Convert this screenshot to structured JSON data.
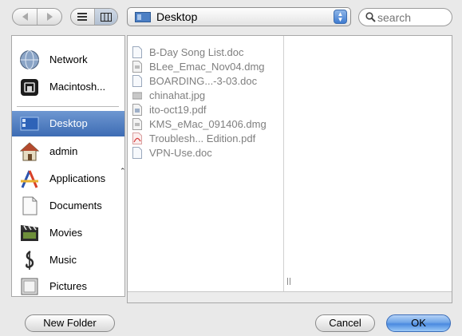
{
  "toolbar": {
    "location": "Desktop",
    "search_placeholder": "search"
  },
  "sidebar": {
    "items": [
      {
        "label": "Network",
        "icon": "network-globe-icon"
      },
      {
        "label": "Macintosh...",
        "icon": "hard-drive-icon"
      },
      {
        "label": "Desktop",
        "icon": "desktop-icon",
        "selected": true
      },
      {
        "label": "admin",
        "icon": "home-icon"
      },
      {
        "label": "Applications",
        "icon": "applications-icon"
      },
      {
        "label": "Documents",
        "icon": "documents-icon"
      },
      {
        "label": "Movies",
        "icon": "movies-icon"
      },
      {
        "label": "Music",
        "icon": "music-icon"
      },
      {
        "label": "Pictures",
        "icon": "pictures-icon"
      }
    ]
  },
  "files": [
    {
      "name": "B-Day Song List.doc",
      "icon": "document-icon"
    },
    {
      "name": "BLee_Emac_Nov04.dmg",
      "icon": "disk-image-icon"
    },
    {
      "name": "BOARDING...-3-03.doc",
      "icon": "document-icon"
    },
    {
      "name": "chinahat.jpg",
      "icon": "image-file-icon"
    },
    {
      "name": "ito-oct19.pdf",
      "icon": "pdf-icon"
    },
    {
      "name": "KMS_eMac_091406.dmg",
      "icon": "disk-image-icon"
    },
    {
      "name": "Troublesh... Edition.pdf",
      "icon": "acrobat-pdf-icon"
    },
    {
      "name": "VPN-Use.doc",
      "icon": "document-icon"
    }
  ],
  "buttons": {
    "new_folder": "New Folder",
    "cancel": "Cancel",
    "ok": "OK"
  },
  "colors": {
    "selection": "#3d6cb4",
    "default_button": "#4a8ae0",
    "disabled_text": "#7f7f7f"
  }
}
